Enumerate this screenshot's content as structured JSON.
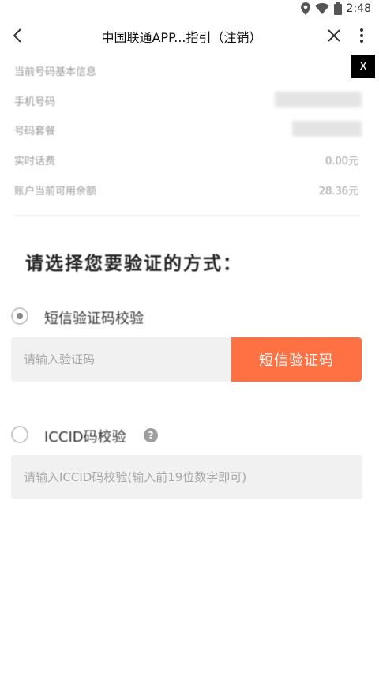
{
  "status_bar": {
    "time": "2:48",
    "icons": [
      "location-icon",
      "wifi-icon",
      "battery-icon"
    ]
  },
  "nav": {
    "title": "中国联通APP...指引（注销）",
    "icons": [
      "back-icon",
      "close-icon",
      "more-icon"
    ]
  },
  "info": {
    "section_title": "当前号码基本信息",
    "rows": [
      {
        "label": "手机号码",
        "value": ""
      },
      {
        "label": "号码套餐",
        "value": ""
      },
      {
        "label": "实时话费",
        "value": "0.00元"
      },
      {
        "label": "账户当前可用余额",
        "value": "28.36元"
      }
    ]
  },
  "overlay_close": "X",
  "heading": "请选择您要验证的方式：",
  "options": {
    "sms": {
      "label": "短信验证码校验",
      "placeholder": "请输入验证码",
      "button": "短信验证码",
      "checked": true
    },
    "iccid": {
      "label": "ICCID码校验",
      "help": "?",
      "placeholder": "请输入ICCID码校验(输入前19位数字即可)",
      "checked": false
    }
  },
  "colors": {
    "accent": "#ff7043",
    "input_bg": "#f1f1f1",
    "muted_text": "#9a9a9a"
  }
}
